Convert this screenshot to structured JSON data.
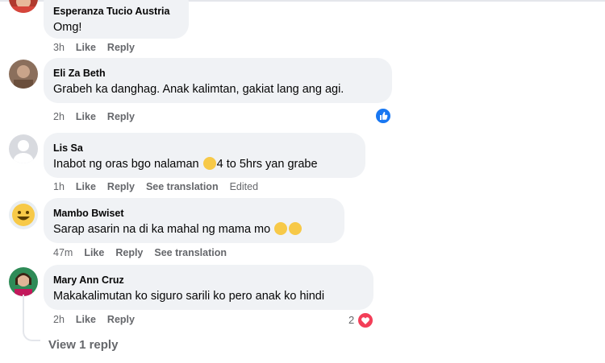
{
  "comments": [
    {
      "name": "Esperanza Tucio Austria",
      "text": "Omg!",
      "time": "3h",
      "like": "Like",
      "reply": "Reply"
    },
    {
      "name": "Eli Za Beth",
      "text": "Grabeh ka danghag. Anak kalimtan, gakiat lang ang agi.",
      "time": "2h",
      "like": "Like",
      "reply": "Reply",
      "reaction": "like-reaction"
    },
    {
      "name": "Lis Sa",
      "text_before": "Inabot ng oras bgo nalaman ",
      "emoji": "weary-face-icon",
      "text_after": "4 to 5hrs yan grabe",
      "time": "1h",
      "like": "Like",
      "reply": "Reply",
      "see_translation": "See translation",
      "edited": "Edited"
    },
    {
      "name": "Mambo Bwiset",
      "text": "Sarap asarin na di ka mahal ng mama mo ",
      "emojis": [
        "rolling-on-floor-laughing-icon",
        "face-with-tears-of-joy-icon"
      ],
      "time": "47m",
      "like": "Like",
      "reply": "Reply",
      "see_translation": "See translation"
    },
    {
      "name": "Mary Ann Cruz",
      "text": "Makakalimutan ko siguro sarili ko pero anak ko hindi",
      "time": "2h",
      "like": "Like",
      "reply": "Reply",
      "reaction_count": "2",
      "reaction": "heart-reaction"
    }
  ],
  "view_replies": "View 1 reply",
  "colors": {
    "bubble": "#f0f2f5",
    "meta": "#65676b",
    "like_blue": "#1877f2",
    "heart_red": "#f33e58"
  }
}
